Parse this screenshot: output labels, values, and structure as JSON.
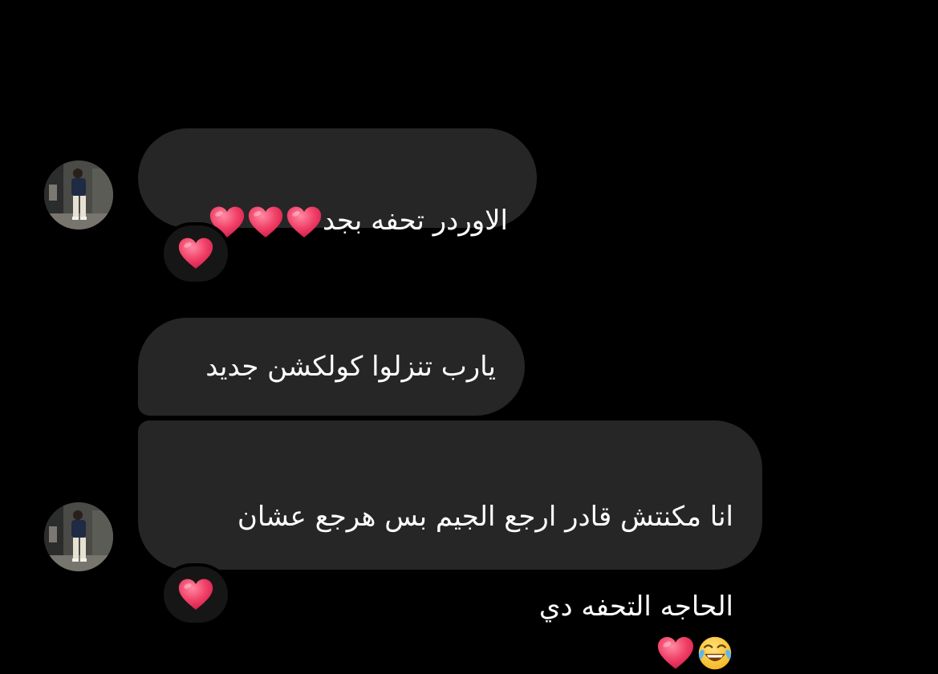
{
  "colors": {
    "background": "#000000",
    "bubble": "#262626",
    "reaction_bg": "#161616",
    "text": "#ffffff",
    "heart": "#f2446a"
  },
  "messages": [
    {
      "text": "الاوردر تحفه بجد",
      "inline_emojis": [
        "red-heart-icon",
        "red-heart-icon",
        "red-heart-icon"
      ],
      "reaction": "red-heart-icon"
    },
    {
      "text": "يارب تنزلوا كولكشن جديد",
      "inline_emojis": []
    },
    {
      "line1": "انا مكنتش قادر ارجع الجيم بس هرجع عشان",
      "line2": "الحاجه التحفه دي",
      "inline_emojis": [
        "tears-of-joy-icon",
        "red-heart-icon"
      ],
      "reaction": "red-heart-icon"
    }
  ]
}
